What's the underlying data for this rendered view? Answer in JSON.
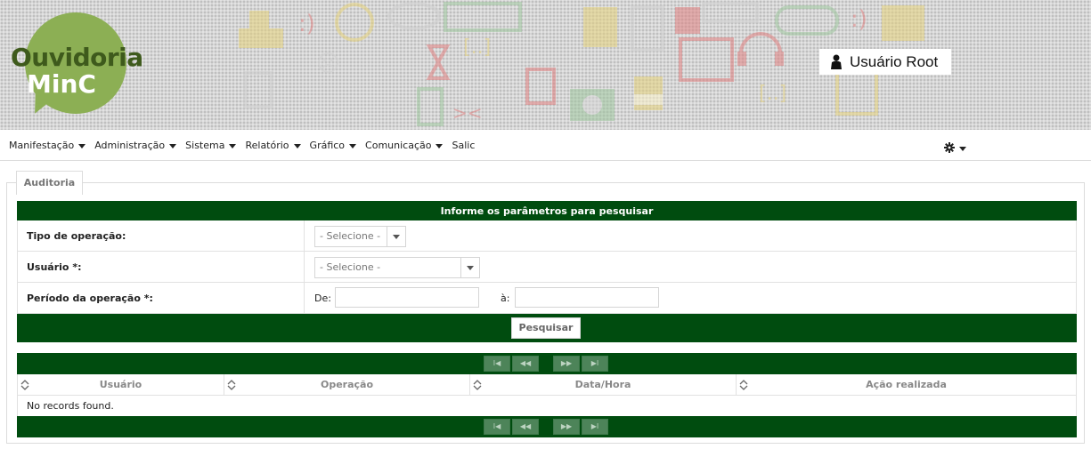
{
  "header": {
    "logo_line1": "Ouvidoria",
    "logo_line2": "MinC",
    "user_name": "Usuário Root"
  },
  "menu": {
    "items": [
      {
        "label": "Manifestação",
        "dropdown": true
      },
      {
        "label": "Administração",
        "dropdown": true
      },
      {
        "label": "Sistema",
        "dropdown": true
      },
      {
        "label": "Relatório",
        "dropdown": true
      },
      {
        "label": "Gráfico",
        "dropdown": true
      },
      {
        "label": "Comunicação",
        "dropdown": true
      },
      {
        "label": "Salic",
        "dropdown": false
      }
    ],
    "settings_icon": "gear-icon"
  },
  "panel": {
    "tab_label": "Auditoria"
  },
  "form": {
    "header": "Informe os parâmetros para pesquisar",
    "tipo_label": "Tipo de operação:",
    "tipo_value": "- Selecione -",
    "usuario_label": "Usuário *:",
    "usuario_value": "- Selecione -",
    "periodo_label": "Período da operação *:",
    "de_label": "De:",
    "ate_label": "à:",
    "de_value": "",
    "ate_value": "",
    "search_button": "Pesquisar"
  },
  "table": {
    "columns": [
      "Usuário",
      "Operação",
      "Data/Hora",
      "Ação realizada"
    ],
    "empty_message": "No records found.",
    "paginator": {
      "first": "I◀",
      "prev": "◀◀",
      "next": "▶▶",
      "last": "▶I"
    }
  },
  "colors": {
    "brand_dark_green": "#004c0f",
    "logo_green": "#8caf54",
    "logo_text_dark": "#3e5a1c",
    "pager_button": "#4d8459"
  }
}
